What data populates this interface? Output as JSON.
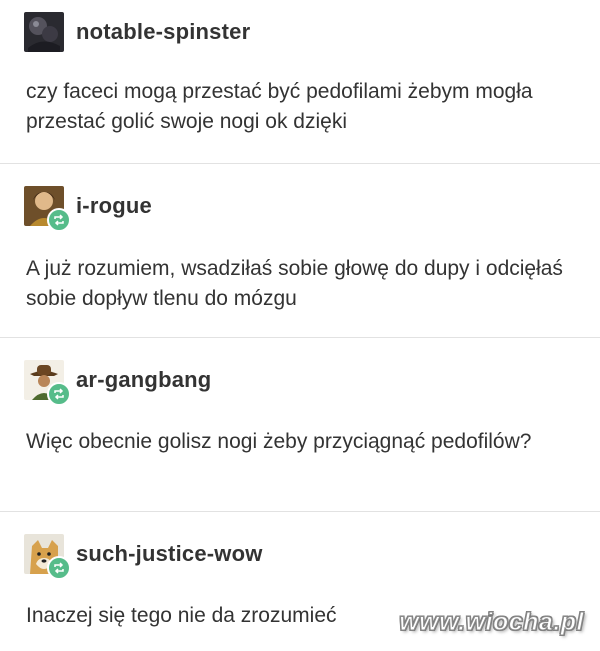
{
  "colors": {
    "text": "#333333",
    "divider": "#e2e2e2",
    "reblog_badge": "#56bc8a"
  },
  "posts": [
    {
      "username": "notable-spinster",
      "avatar_icon": "avatar-dark-photo",
      "reblog": false,
      "text": "czy faceci mogą przestać być pedofilami żebym mogła przestać golić swoje nogi ok dzięki"
    },
    {
      "username": "i-rogue",
      "avatar_icon": "avatar-portrait",
      "reblog": true,
      "text": "A już rozumiem, wsadziłaś sobie głowę do dupy i odcięłaś sobie dopływ tlenu do mózgu"
    },
    {
      "username": "ar-gangbang",
      "avatar_icon": "avatar-cowboy",
      "reblog": true,
      "text": "Więc obecnie golisz nogi żeby przyciągnąć pedofilów?"
    },
    {
      "username": "such-justice-wow",
      "avatar_icon": "avatar-doge",
      "reblog": true,
      "text": "Inaczej się tego nie da zrozumieć"
    }
  ],
  "watermark": "www.wiocha.pl"
}
